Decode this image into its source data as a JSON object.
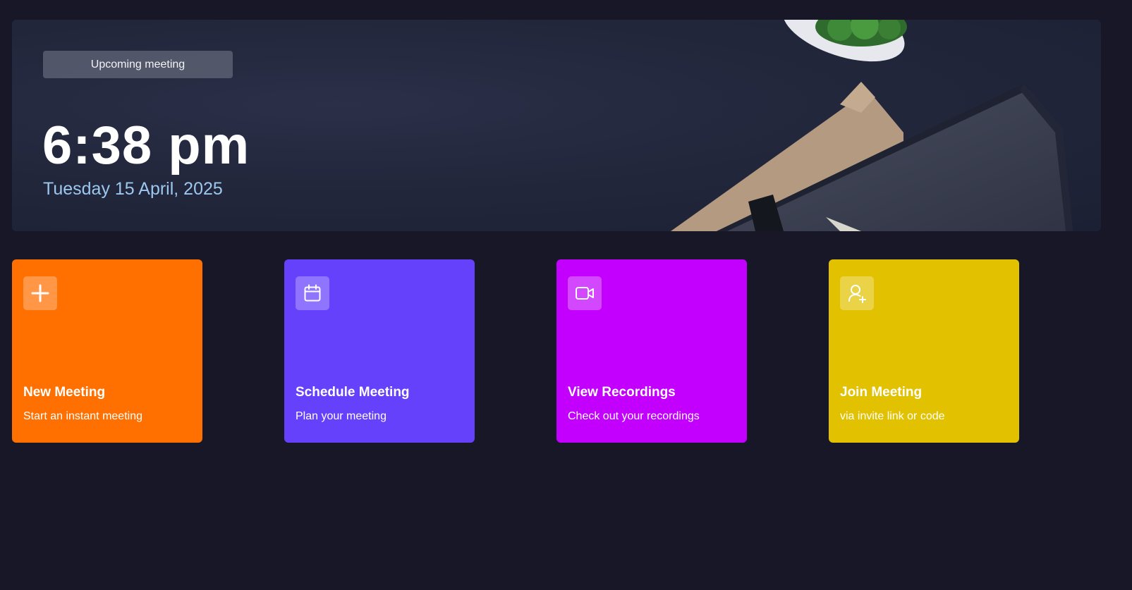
{
  "hero": {
    "badge_label": "Upcoming meeting",
    "time": "6:38 pm",
    "date": "Tuesday 15 April, 2025"
  },
  "cards": [
    {
      "title": "New Meeting",
      "subtitle": "Start an instant meeting",
      "icon": "plus-icon",
      "color": "#FF7000"
    },
    {
      "title": "Schedule Meeting",
      "subtitle": "Plan your meeting",
      "icon": "calendar-icon",
      "color": "#6541FC"
    },
    {
      "title": "View Recordings",
      "subtitle": "Check out your recordings",
      "icon": "video-icon",
      "color": "#C300FE"
    },
    {
      "title": "Join Meeting",
      "subtitle": "via invite link or code",
      "icon": "user-plus-icon",
      "color": "#E2C200"
    }
  ],
  "colors": {
    "background": "#181728",
    "date_text": "#9CC7EE"
  }
}
